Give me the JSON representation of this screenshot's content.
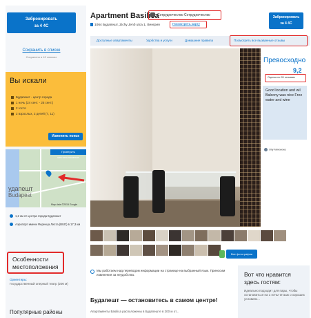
{
  "sidebar": {
    "book_button": "Забронировать\nза 4 4С",
    "save_link": "Сохранить в списке",
    "save_sub": "Сохранено в 42 списках",
    "search": {
      "title": "Вы искали",
      "rows": [
        "Будапешт - центр города",
        "1 ночь (24 сент. - 25 сент.)",
        "2 гостя",
        "2 взрослых, 2 детей (7, 11)"
      ],
      "change_button": "Изменить поиск"
    },
    "map": {
      "top_button": "Проверить местоположение",
      "label_local": "удапешт",
      "label_latin": "Budapest",
      "copyright": "Map data ©2015 Google"
    },
    "distances": [
      "1,2 км от центра города Будапешт",
      "Аэропорт имени Ференца Листа (BUD) в 17,3 км"
    ],
    "location_highlights": "Особенности местоположения",
    "attractions_label": "Ориентиры:",
    "attractions_value": "Государственный оперный театр (200 м)",
    "popular": "Популярные районы"
  },
  "header": {
    "title": "Apartment Basilica",
    "preferred": "Сотрудничество Сотрудничество",
    "address": "1064 Будапешт, Zichy Jenő utca 1, Венгрия",
    "show_map": "Посмотреть карту",
    "book_button": "Забронировать\nза 4 4С",
    "tabs": [
      "Доступные апартаменты",
      "Удобства и услуги",
      "Домашние правила"
    ],
    "reviews_tab": "Посмотреть все вызванные отзывы"
  },
  "review": {
    "rating_word": "Превосходно",
    "score": "9,2",
    "based_on": "Оценка по 95 отзывам",
    "quote": "Good location and wil Balcony was nice Free water and wine",
    "reviewer": "Olly Минэнэко"
  },
  "gallery": {
    "all_photos": "Все фотографии (показать)",
    "thumb_colors": [
      "#6d5a4a",
      "#c9c1b3",
      "#2e2a27",
      "#b7aa98",
      "#5d4c3e",
      "#d9d2c6",
      "#3b3432",
      "#a29585",
      "#7f6e5d",
      "#c3b8a8",
      "#4c4039",
      "#8b7b6b",
      "#e0d7ca",
      "#5b4a3f",
      "#9f8f7e",
      "#7a6a5a",
      "#b5a894",
      "#3f3733",
      "#cfc6b6",
      "#5f5045",
      "#a39383",
      "#2f2925",
      "#8e7f6f",
      "#cbbfae",
      "#57483c",
      "#b8ab9a",
      "#40372f"
    ]
  },
  "info": {
    "notice": "Мы работаем над переводом информации на странице на выбранный язык. Приносим извинения за неудобства.",
    "headline": "Будапешт — остановитесь в самом центре!",
    "sub": "Апартаменты Basilica расположены в Будапеште в 200 м от..."
  },
  "likes": {
    "title": "Вот что нравится здесь гостям:",
    "sub": "Идеально подходит для пары, чтобы остановиться на 1 ночь! Отзыв о хороших условиях..."
  },
  "colors": {
    "accent": "#0a73c9",
    "highlight_red": "#e22a2a",
    "search_bg": "#fbbd3b"
  }
}
